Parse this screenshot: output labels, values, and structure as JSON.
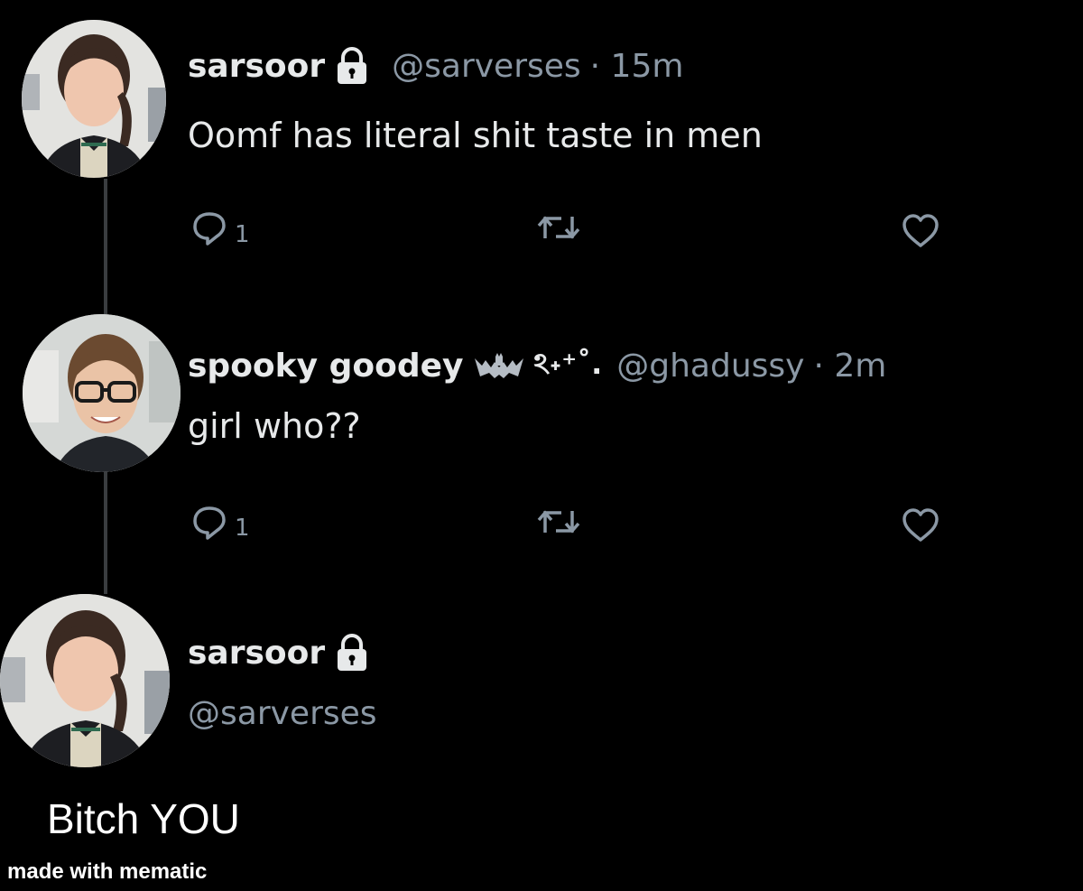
{
  "tweets": [
    {
      "name": "sarsoor",
      "handle": "@sarverses",
      "time": "· 15m",
      "text": "Oomf has literal shit taste in men",
      "reply_count": "1",
      "locked": true
    },
    {
      "name": "spooky goodey",
      "name_emoji": "ঽ˖⁺˚.",
      "handle": "@ghadussy",
      "time": "· 2m",
      "text": "girl who??",
      "reply_count": "1",
      "locked": false
    },
    {
      "name": "sarsoor",
      "handle": "@sarverses",
      "locked": true
    }
  ],
  "caption": "Bitch YOU",
  "watermark": "made with mematic",
  "icons": [
    "lock-icon",
    "reply-icon",
    "retweet-icon",
    "like-icon",
    "bat-icon"
  ]
}
